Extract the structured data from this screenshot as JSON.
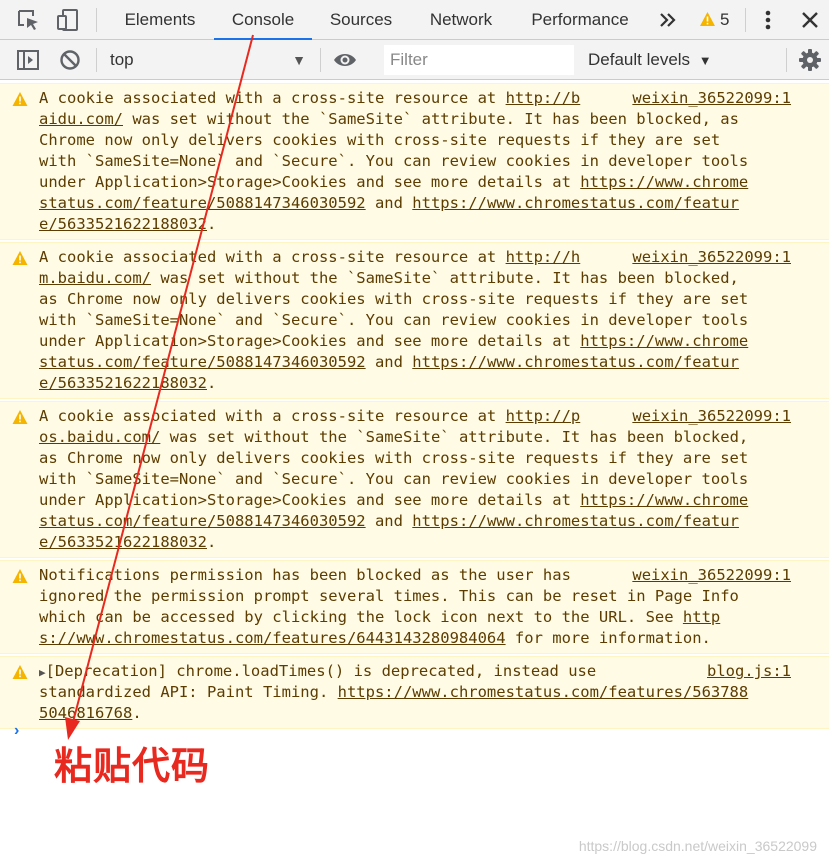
{
  "tabs": [
    "Elements",
    "Console",
    "Sources",
    "Network",
    "Performance"
  ],
  "more_tabs_icon": "double-chevron-icon",
  "warning_count": "5",
  "toolbar": {
    "context": "top",
    "filter_placeholder": "Filter",
    "levels": "Default levels"
  },
  "messages": [
    {
      "lines": [
        [
          {
            "t": "A cookie associated with a cross-site resource at "
          },
          {
            "t": "http://b",
            "u": true
          }
        ],
        [
          {
            "t": "aidu.com/",
            "u": true
          },
          {
            "t": " was set without the `SameSite` attribute. It has been blocked, as"
          }
        ],
        [
          {
            "t": "Chrome now only delivers cookies with cross-site requests if they are set"
          }
        ],
        [
          {
            "t": "with `SameSite=None` and `Secure`. You can review cookies in developer tools"
          }
        ],
        [
          {
            "t": "under Application>Storage>Cookies and see more details at "
          },
          {
            "t": "https://www.chrome",
            "u": true
          }
        ],
        [
          {
            "t": "status.com/feature/5088147346030592",
            "u": true
          },
          {
            "t": " and "
          },
          {
            "t": "https://www.chromestatus.com/featur",
            "u": true
          }
        ],
        [
          {
            "t": "e/5633521622188032",
            "u": true
          },
          {
            "t": "."
          }
        ]
      ],
      "source": "weixin_36522099:1"
    },
    {
      "lines": [
        [
          {
            "t": "A cookie associated with a cross-site resource at "
          },
          {
            "t": "http://h",
            "u": true
          }
        ],
        [
          {
            "t": "m.baidu.com/",
            "u": true
          },
          {
            "t": " was set without the `SameSite` attribute. It has been blocked,"
          }
        ],
        [
          {
            "t": "as Chrome now only delivers cookies with cross-site requests if they are set"
          }
        ],
        [
          {
            "t": "with `SameSite=None` and `Secure`. You can review cookies in developer tools"
          }
        ],
        [
          {
            "t": "under Application>Storage>Cookies and see more details at "
          },
          {
            "t": "https://www.chrome",
            "u": true
          }
        ],
        [
          {
            "t": "status.com/feature/5088147346030592",
            "u": true
          },
          {
            "t": " and "
          },
          {
            "t": "https://www.chromestatus.com/featur",
            "u": true
          }
        ],
        [
          {
            "t": "e/5633521622188032",
            "u": true
          },
          {
            "t": "."
          }
        ]
      ],
      "source": "weixin_36522099:1"
    },
    {
      "lines": [
        [
          {
            "t": "A cookie associated with a cross-site resource at "
          },
          {
            "t": "http://p",
            "u": true
          }
        ],
        [
          {
            "t": "os.baidu.com/",
            "u": true
          },
          {
            "t": " was set without the `SameSite` attribute. It has been blocked,"
          }
        ],
        [
          {
            "t": "as Chrome now only delivers cookies with cross-site requests if they are set"
          }
        ],
        [
          {
            "t": "with `SameSite=None` and `Secure`. You can review cookies in developer tools"
          }
        ],
        [
          {
            "t": "under Application>Storage>Cookies and see more details at "
          },
          {
            "t": "https://www.chrome",
            "u": true
          }
        ],
        [
          {
            "t": "status.com/feature/5088147346030592",
            "u": true
          },
          {
            "t": " and "
          },
          {
            "t": "https://www.chromestatus.com/featur",
            "u": true
          }
        ],
        [
          {
            "t": "e/5633521622188032",
            "u": true
          },
          {
            "t": "."
          }
        ]
      ],
      "source": "weixin_36522099:1"
    },
    {
      "lines": [
        [
          {
            "t": "Notifications permission has been blocked as the user has"
          }
        ],
        [
          {
            "t": "ignored the permission prompt several times. This can be reset in Page Info"
          }
        ],
        [
          {
            "t": "which can be accessed by clicking the lock icon next to the URL. See "
          },
          {
            "t": "http",
            "u": true
          }
        ],
        [
          {
            "t": "s://www.chromestatus.com/features/6443143280984064",
            "u": true
          },
          {
            "t": " for more information."
          }
        ]
      ],
      "source": "weixin_36522099:1"
    },
    {
      "lines": [
        [
          {
            "t": "▶",
            "x": true
          },
          {
            "t": "[Deprecation] chrome.loadTimes() is deprecated, instead use"
          }
        ],
        [
          {
            "t": "standardized API: Paint Timing. "
          },
          {
            "t": "https://www.chromestatus.com/features/563788",
            "u": true
          }
        ],
        [
          {
            "t": "5046816768",
            "u": true
          },
          {
            "t": "."
          }
        ]
      ],
      "source": "blog.js:1"
    }
  ],
  "prompt_symbol": "›",
  "annotation": "粘贴代码",
  "watermark": "https://blog.csdn.net/weixin_36522099",
  "colors": {
    "warning_bg": "#fffbe5",
    "warning_text": "#5c3c00",
    "warning_icon": "#f4b400",
    "active_tab": "#1a73e8",
    "annotation": "#e8291f"
  }
}
